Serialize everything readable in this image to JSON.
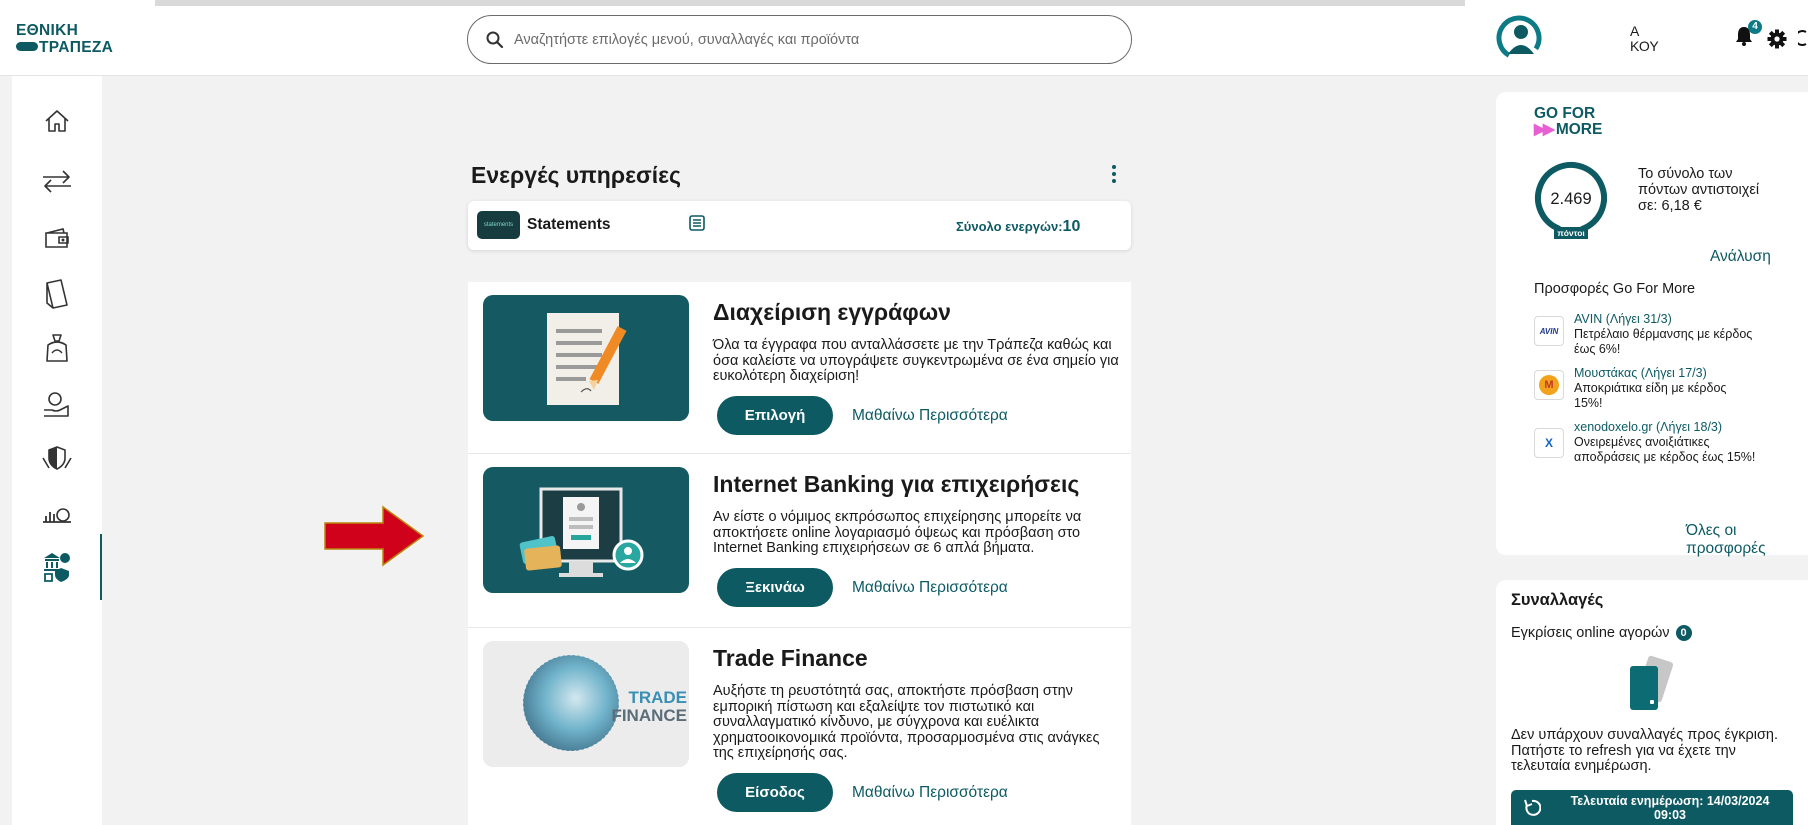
{
  "brand": {
    "line1": "ΕΘΝΙΚΗ",
    "line2": "ΤΡΑΠΕΖΑ"
  },
  "search": {
    "placeholder": "Αναζητήστε επιλογές μενού, συναλλαγές και προϊόντα"
  },
  "user": {
    "name_line1": "Α",
    "name_line2": "ΚΟΥ"
  },
  "notifications": {
    "count": "4"
  },
  "sidebar": {
    "items": [
      {
        "icon": "home-icon"
      },
      {
        "icon": "transfers-icon"
      },
      {
        "icon": "wallet-icon"
      },
      {
        "icon": "cards-icon"
      },
      {
        "icon": "savings-icon"
      },
      {
        "icon": "loans-icon"
      },
      {
        "icon": "insurance-icon"
      },
      {
        "icon": "investments-icon"
      },
      {
        "icon": "services-icon"
      }
    ],
    "active_index": 8
  },
  "main": {
    "title": "Ενεργές υπηρεσίες",
    "statements": {
      "logo_text": "statements",
      "name": "Statements",
      "total_label": "Σύνολο ενεργών:",
      "total_value": "10"
    },
    "services": [
      {
        "title": "Διαχείριση εγγράφων",
        "description": "Όλα τα έγγραφα που ανταλλάσσετε με την Τράπεζα καθώς και όσα καλείστε να υπογράψετε συγκεντρωμένα σε ένα σημείο για ευκολότερη διαχείριση!",
        "button": "Επιλογή",
        "link": "Μαθαίνω Περισσότερα"
      },
      {
        "title": "Internet Banking για επιχειρήσεις",
        "description": "Αν είστε ο νόμιμος εκπρόσωπος επιχείρησης μπορείτε να αποκτήσετε online λογαριασμό όψεως και πρόσβαση στο Internet Banking επιχειρήσεων σε 6 απλά βήματα.",
        "button": "Ξεκινάω",
        "link": "Μαθαίνω Περισσότερα"
      },
      {
        "title": "Trade Finance",
        "image_text_1": "TRADE",
        "image_text_2": "FINANCE",
        "description": "Αυξήστε τη ρευστότητά σας, αποκτήστε πρόσβαση στην εμπορική πίστωση και εξαλείψτε τον πιστωτικό και συναλλαγματικό κίνδυνο, με σύγχρονα και ευέλικτα χρηματοοικονομικά προϊόντα, προσαρμοσμένα στις ανάγκες της επιχείρησής σας.",
        "button": "Είσοδος",
        "link": "Μαθαίνω Περισσότερα"
      }
    ]
  },
  "go_for_more": {
    "logo_line1": "GO FOR",
    "logo_line2": "MORE",
    "points": "2.469",
    "points_label": "πόντοι",
    "points_text": "Το σύνολο των πόντων αντιστοιχεί σε: 6,18 €",
    "analysis": "Ανάλυση",
    "offers_title": "Προσφορές Go For More",
    "offers": [
      {
        "logo": "AVIN",
        "name": "AVIN (Λήγει 31/3)",
        "desc": "Πετρέλαιο θέρμανσης με κέρδος έως 6%!"
      },
      {
        "logo": "M",
        "name": "Μουστάκας (Λήγει 17/3)",
        "desc": "Αποκριάτικα είδη με κέρδος 15%!"
      },
      {
        "logo": "X",
        "name": "xenodoxelo.gr (Λήγει 18/3)",
        "desc": "Ονειρεμένες ανοιξιάτικες αποδράσεις με κέρδος έως 15%!"
      }
    ],
    "all_offers": "Όλες οι προσφορές"
  },
  "transactions": {
    "title": "Συναλλαγές",
    "approvals_label": "Εγκρίσεις online αγορών",
    "approvals_count": "0",
    "empty_text": "Δεν υπάρχουν συναλλαγές προς έγκριση. Πατήστε το refresh για να έχετε την τελευταία ενημέρωση.",
    "last_update": "Τελευταία ενημέρωση: 14/03/2024 09:03"
  },
  "colors": {
    "primary": "#0d5a63",
    "arrow": "#d0021b",
    "gfm_accent": "#e75fd2"
  }
}
